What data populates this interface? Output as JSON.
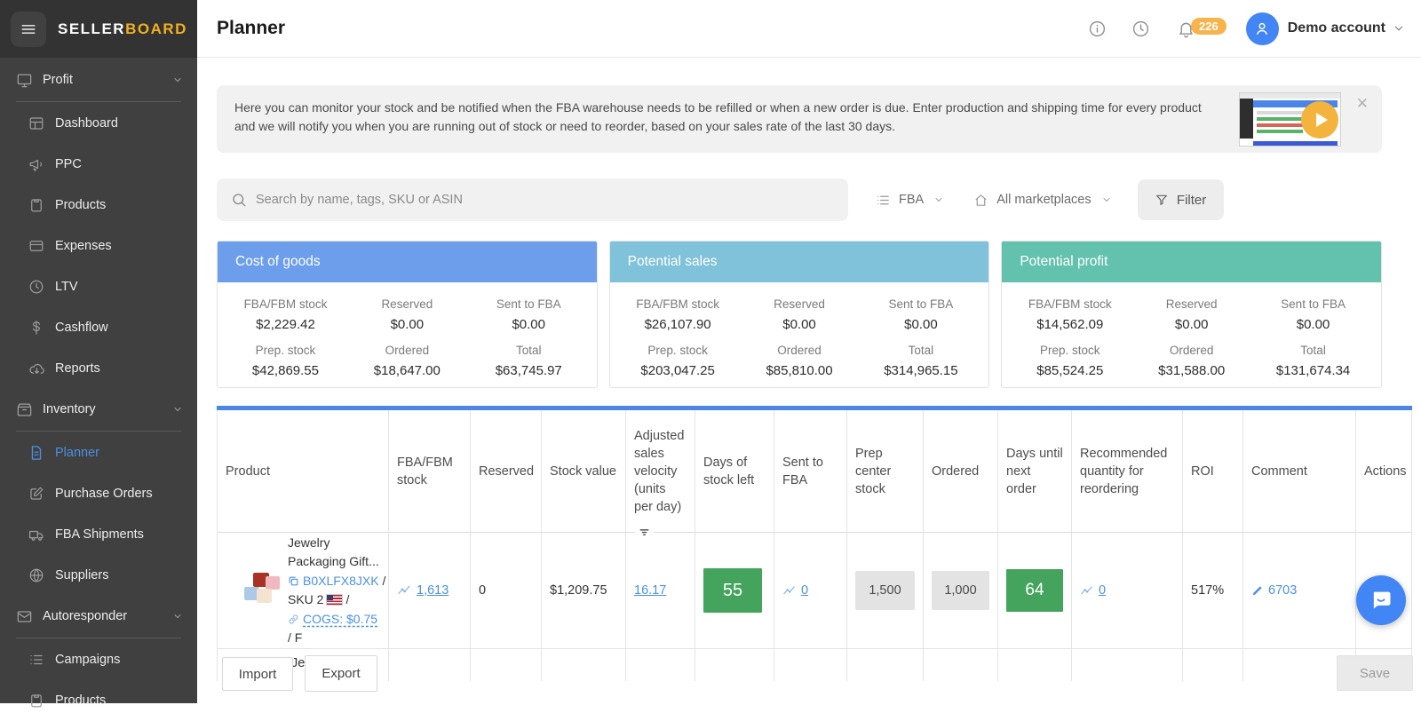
{
  "brand": {
    "seller": "SELLER",
    "board": "BOARD"
  },
  "header": {
    "title": "Planner",
    "notification_count": "226",
    "account_name": "Demo account"
  },
  "sidebar": {
    "items": [
      {
        "label": "Profit"
      },
      {
        "label": "Dashboard"
      },
      {
        "label": "PPC"
      },
      {
        "label": "Products"
      },
      {
        "label": "Expenses"
      },
      {
        "label": "LTV"
      },
      {
        "label": "Cashflow"
      },
      {
        "label": "Reports"
      },
      {
        "label": "Inventory"
      },
      {
        "label": "Planner"
      },
      {
        "label": "Purchase Orders"
      },
      {
        "label": "FBA Shipments"
      },
      {
        "label": "Suppliers"
      },
      {
        "label": "Autoresponder"
      },
      {
        "label": "Campaigns"
      },
      {
        "label": "Products"
      }
    ]
  },
  "banner": {
    "text": "Here you can monitor your stock and be notified when the FBA warehouse needs to be refilled or when a new order is due. Enter production and shipping time for every product and we will notify you when you are running out of stock or need to reorder, based on your sales rate of the last 30 days.",
    "close": "✕"
  },
  "toolbar": {
    "search_placeholder": "Search by name, tags, SKU or ASIN",
    "fulfillment_filter": "FBA",
    "marketplace_filter": "All marketplaces",
    "filter_label": "Filter"
  },
  "summary_cards": [
    {
      "title": "Cost of goods",
      "header_color": "#6d9eeb",
      "stats": [
        {
          "label": "FBA/FBM stock",
          "value": "$2,229.42"
        },
        {
          "label": "Reserved",
          "value": "$0.00"
        },
        {
          "label": "Sent to FBA",
          "value": "$0.00"
        },
        {
          "label": "Prep. stock",
          "value": "$42,869.55"
        },
        {
          "label": "Ordered",
          "value": "$18,647.00"
        },
        {
          "label": "Total",
          "value": "$63,745.97"
        }
      ]
    },
    {
      "title": "Potential sales",
      "header_color": "#7fc2d9",
      "stats": [
        {
          "label": "FBA/FBM stock",
          "value": "$26,107.90"
        },
        {
          "label": "Reserved",
          "value": "$0.00"
        },
        {
          "label": "Sent to FBA",
          "value": "$0.00"
        },
        {
          "label": "Prep. stock",
          "value": "$203,047.25"
        },
        {
          "label": "Ordered",
          "value": "$85,810.00"
        },
        {
          "label": "Total",
          "value": "$314,965.15"
        }
      ]
    },
    {
      "title": "Potential profit",
      "header_color": "#62c2ad",
      "stats": [
        {
          "label": "FBA/FBM stock",
          "value": "$14,562.09"
        },
        {
          "label": "Reserved",
          "value": "$0.00"
        },
        {
          "label": "Sent to FBA",
          "value": "$0.00"
        },
        {
          "label": "Prep. stock",
          "value": "$85,524.25"
        },
        {
          "label": "Ordered",
          "value": "$31,588.00"
        },
        {
          "label": "Total",
          "value": "$131,674.34"
        }
      ]
    }
  ],
  "table": {
    "columns": [
      "Product",
      "FBA/FBM stock",
      "Reserved",
      "Stock value",
      "Adjusted sales velocity (units per day)",
      "Days of stock left",
      "Sent to FBA",
      "Prep center stock",
      "Ordered",
      "Days until next order",
      "Recommended quantity for reordering",
      "ROI",
      "Comment",
      "Actions"
    ],
    "row": {
      "product": {
        "line1": "Jewelry",
        "line2": "Packaging Gift...",
        "asin": "B0XLFX8JXK",
        "asin_sep": "/",
        "sku": "SKU 2",
        "sku_sep": "/",
        "cogs": "COGS: $0.75",
        "more": "/ F"
      },
      "fba_fbm_stock": "1,613",
      "reserved": "0",
      "stock_value": "$1,209.75",
      "adjusted_sales_velocity": "16.17",
      "days_of_stock_left": "55",
      "sent_to_fba": "0",
      "prep_center_stock": "1,500",
      "ordered": "1,000",
      "days_until_next_order": "64",
      "recommended_quantity": "0",
      "roi": "517%",
      "comment": "6703"
    },
    "next_row_preview": "Jewelry Blue"
  },
  "footer": {
    "import_label": "Import",
    "export_label": "Export",
    "save_label": "Save"
  },
  "colors": {
    "accent_blue": "#4a86e8",
    "link_blue": "#4a90e2",
    "green_badge": "#44a45d",
    "notification_badge": "#f6b44b",
    "logo_yellow": "#f2b01e"
  }
}
